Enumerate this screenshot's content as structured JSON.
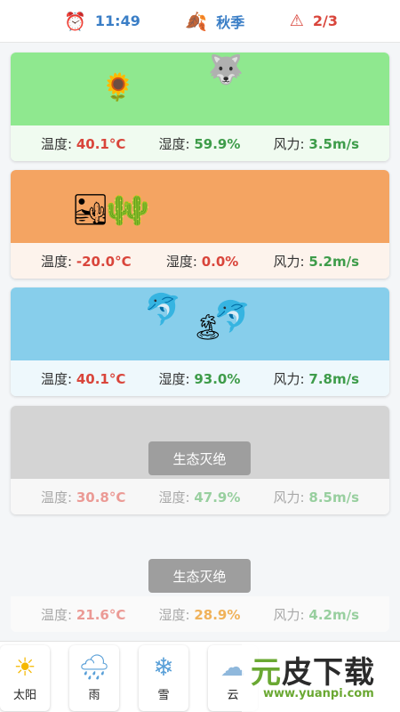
{
  "header": {
    "clock_icon": "alarm-clock-icon",
    "time": "11:49",
    "season_icon": "autumn-leaves-icon",
    "season": "秋季",
    "warning_icon": "warning-triangle-icon",
    "lives": "2/3"
  },
  "labels": {
    "temp": "温度:",
    "humidity": "湿度:",
    "wind": "风力:"
  },
  "cards": [
    {
      "bg": "#8fe88f",
      "temp": "40.1°C",
      "humidity": "59.9%",
      "wind": "3.5m/s",
      "icons": [
        "sunflower-icon",
        "wolf-icon"
      ],
      "glyphs": [
        "🌻",
        "🐺"
      ]
    },
    {
      "bg": "#f4a462",
      "temp": "-20.0°C",
      "humidity": "0.0%",
      "wind": "5.2m/s",
      "icons": [
        "desert-icon",
        "cactus-icon"
      ],
      "glyphs": [
        "🏜",
        "🌵"
      ]
    },
    {
      "bg": "#87ceeb",
      "temp": "40.1°C",
      "humidity": "93.0%",
      "wind": "7.8m/s",
      "icons": [
        "dolphin-icon",
        "island-dolphin-icon"
      ],
      "glyphs": [
        "🐬",
        "🐬"
      ]
    },
    {
      "bg": "#d4d4d4",
      "temp": "30.8°C",
      "humidity": "47.9%",
      "wind": "8.5m/s",
      "extinct_label": "生态灭绝"
    },
    {
      "bg": "#f4f6f8",
      "temp": "21.6°C",
      "humidity": "28.9%",
      "wind": "4.2m/s",
      "extinct_label": "生态灭绝"
    }
  ],
  "tools": [
    {
      "icon": "sun-icon",
      "glyph": "☀",
      "label": "太阳"
    },
    {
      "icon": "rain-cloud-icon",
      "glyph": "🌧",
      "label": "雨"
    },
    {
      "icon": "snowflake-icon",
      "glyph": "❄",
      "label": "雪"
    },
    {
      "icon": "cloud-icon",
      "glyph": "☁",
      "label": "云"
    }
  ],
  "watermark": {
    "text_a": "元",
    "text_b": "皮下载",
    "url": "www.yuanpi.com"
  }
}
